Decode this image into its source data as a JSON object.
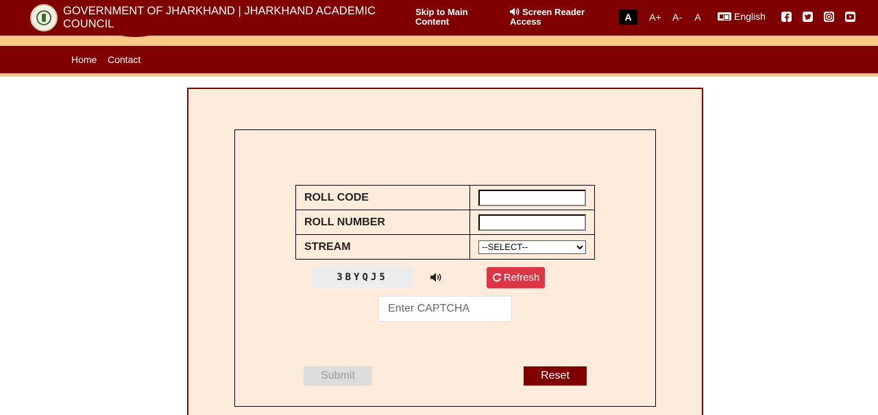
{
  "header": {
    "site_title": "GOVERNMENT OF JHARKHAND | JHARKHAND ACADEMIC COUNCIL",
    "skip_link": "Skip to Main Content",
    "screen_reader": "Screen Reader Access",
    "font_sizes": [
      "A",
      "A+",
      "A-",
      "A"
    ],
    "language": "English",
    "social_icons": [
      "facebook-icon",
      "twitter-icon",
      "instagram-icon",
      "youtube-icon"
    ]
  },
  "nav": {
    "home": "Home",
    "contact": "Contact"
  },
  "form": {
    "roll_code_label": "ROLL CODE",
    "roll_code_value": "",
    "roll_number_label": "ROLL NUMBER",
    "roll_number_value": "",
    "stream_label": "STREAM",
    "stream_selected": "--SELECT--",
    "captcha_text": "3BYQJ5",
    "refresh_label": "Refresh",
    "captcha_placeholder": "Enter CAPTCHA",
    "submit_label": "Submit",
    "reset_label": "Reset"
  },
  "colors": {
    "primary": "#800000",
    "accent_stripe": "#fdc887",
    "panel_bg": "#fdebdc",
    "refresh": "#dc3545"
  }
}
